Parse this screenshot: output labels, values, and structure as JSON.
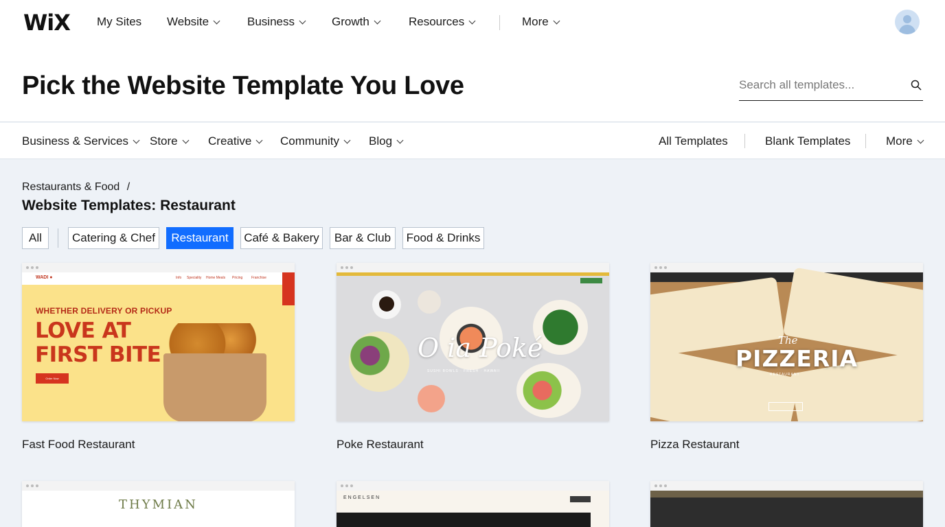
{
  "topnav": {
    "logo": "WiX",
    "items": [
      {
        "label": "My Sites",
        "has_dropdown": false
      },
      {
        "label": "Website",
        "has_dropdown": true
      },
      {
        "label": "Business",
        "has_dropdown": true
      },
      {
        "label": "Growth",
        "has_dropdown": true
      },
      {
        "label": "Resources",
        "has_dropdown": true
      },
      {
        "label": "More",
        "has_dropdown": true
      }
    ]
  },
  "header": {
    "title": "Pick the Website Template You Love",
    "search_placeholder": "Search all templates..."
  },
  "categories": {
    "left": [
      {
        "label": "Business & Services"
      },
      {
        "label": "Store"
      },
      {
        "label": "Creative"
      },
      {
        "label": "Community"
      },
      {
        "label": "Blog"
      }
    ],
    "right": [
      {
        "label": "All Templates"
      },
      {
        "label": "Blank Templates"
      },
      {
        "label": "More"
      }
    ]
  },
  "main": {
    "breadcrumb": "Restaurants & Food",
    "breadcrumb_sep": "/",
    "section_title": "Website Templates: Restaurant",
    "filters": [
      {
        "label": "All",
        "active": false
      },
      {
        "label": "Catering & Chef",
        "active": false
      },
      {
        "label": "Restaurant",
        "active": true
      },
      {
        "label": "Café & Bakery",
        "active": false
      },
      {
        "label": "Bar & Club",
        "active": false
      },
      {
        "label": "Food & Drinks",
        "active": false
      }
    ],
    "templates": [
      {
        "title": "Fast Food Restaurant",
        "preview_small": "WHETHER DELIVERY OR PICKUP",
        "preview_headline_1": "LOVE AT",
        "preview_headline_2": "FIRST BITE"
      },
      {
        "title": "Poke Restaurant",
        "preview_text": "O ia Poké"
      },
      {
        "title": "Pizza Restaurant",
        "preview_kicker": "The",
        "preview_text": "PIZZERIA"
      },
      {
        "title": "",
        "preview_text": "THYMIAN"
      },
      {
        "title": "",
        "preview_text": "ENGELSEN"
      },
      {
        "title": "",
        "preview_text": ""
      }
    ]
  },
  "colors": {
    "accent": "#116dff",
    "background": "#eef2f7"
  }
}
